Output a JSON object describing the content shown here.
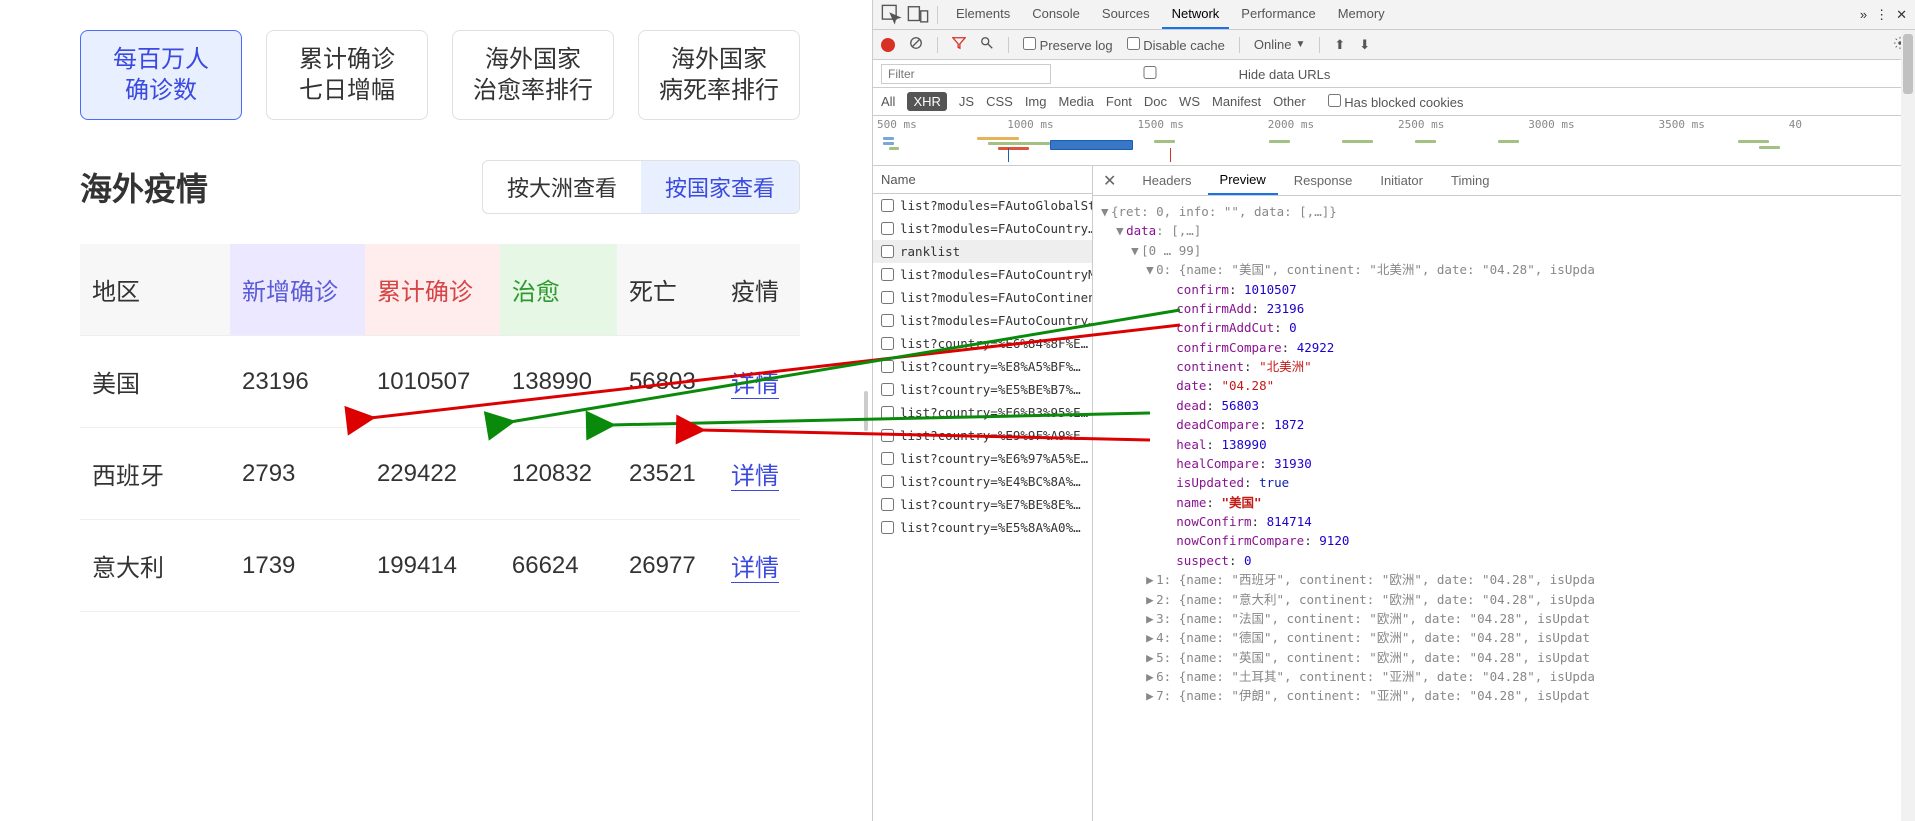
{
  "webpage": {
    "tabs": [
      {
        "line1": "每百万人",
        "line2": "确诊数",
        "active": true
      },
      {
        "line1": "累计确诊",
        "line2": "七日增幅",
        "active": false
      },
      {
        "line1": "海外国家",
        "line2": "治愈率排行",
        "active": false
      },
      {
        "line1": "海外国家",
        "line2": "病死率排行",
        "active": false
      }
    ],
    "section_title": "海外疫情",
    "view_toggle": {
      "by_continent": "按大洲查看",
      "by_country": "按国家查看"
    },
    "columns": {
      "region": "地区",
      "new_confirm": "新增确诊",
      "total_confirm": "累计确诊",
      "heal": "治愈",
      "dead": "死亡",
      "detail": "疫情"
    },
    "detail_link": "详情",
    "rows": [
      {
        "region": "美国",
        "new": "23196",
        "confirm": "1010507",
        "heal": "138990",
        "dead": "56803"
      },
      {
        "region": "西班牙",
        "new": "2793",
        "confirm": "229422",
        "heal": "120832",
        "dead": "23521"
      },
      {
        "region": "意大利",
        "new": "1739",
        "confirm": "199414",
        "heal": "66624",
        "dead": "26977"
      }
    ]
  },
  "devtools": {
    "panels": [
      "Elements",
      "Console",
      "Sources",
      "Network",
      "Performance",
      "Memory"
    ],
    "active_panel": "Network",
    "toolbar": {
      "preserve_log": "Preserve log",
      "disable_cache": "Disable cache",
      "throttle": "Online"
    },
    "filter_placeholder": "Filter",
    "hide_urls": "Hide data URLs",
    "types": [
      "All",
      "XHR",
      "JS",
      "CSS",
      "Img",
      "Media",
      "Font",
      "Doc",
      "WS",
      "Manifest",
      "Other"
    ],
    "active_type": "XHR",
    "blocked_cookies": "Has blocked cookies",
    "timeline_ticks": [
      "500 ms",
      "1000 ms",
      "1500 ms",
      "2000 ms",
      "2500 ms",
      "3000 ms",
      "3500 ms",
      "40"
    ],
    "req_header": "Name",
    "requests": [
      "list?modules=FAutoGlobalSta…",
      "list?modules=FAutoCountry…",
      "ranklist",
      "list?modules=FAutoCountryM…",
      "list?modules=FAutoContinen…",
      "list?modules=FAutoCountry…",
      "list?country=%E6%84%8F%E…",
      "list?country=%E8%A5%BF%…",
      "list?country=%E5%BE%B7%…",
      "list?country=%E6%B3%95%E…",
      "list?country=%E9%9F%A9%E…",
      "list?country=%E6%97%A5%E…",
      "list?country=%E4%BC%8A%…",
      "list?country=%E7%BE%8E%…",
      "list?country=%E5%8A%A0%…"
    ],
    "selected_request": 2,
    "resp_tabs": [
      "Headers",
      "Preview",
      "Response",
      "Initiator",
      "Timing"
    ],
    "active_resp_tab": "Preview",
    "preview": {
      "root": "{ret: 0, info: \"\", data: [,…]}",
      "data_label": "data: [,…]",
      "range": "[0 … 99]",
      "item0": {
        "header": "0: {name: \"美国\", continent: \"北美洲\", date: \"04.28\", isUpda",
        "confirm": 1010507,
        "confirmAdd": 23196,
        "confirmAddCut": 0,
        "confirmCompare": 42922,
        "continent": "北美洲",
        "date": "04.28",
        "dead": 56803,
        "deadCompare": 1872,
        "heal": 138990,
        "healCompare": 31930,
        "isUpdated": true,
        "name": "美国",
        "nowConfirm": 814714,
        "nowConfirmCompare": 9120,
        "suspect": 0
      },
      "rest": [
        "1: {name: \"西班牙\", continent: \"欧洲\", date: \"04.28\", isUpda",
        "2: {name: \"意大利\", continent: \"欧洲\", date: \"04.28\", isUpda",
        "3: {name: \"法国\", continent: \"欧洲\", date: \"04.28\", isUpdat",
        "4: {name: \"德国\", continent: \"欧洲\", date: \"04.28\", isUpdat",
        "5: {name: \"英国\", continent: \"欧洲\", date: \"04.28\", isUpdat",
        "6: {name: \"土耳其\", continent: \"亚洲\", date: \"04.28\", isUpda",
        "7: {name: \"伊朗\", continent: \"亚洲\", date: \"04.28\", isUpdat"
      ]
    }
  }
}
